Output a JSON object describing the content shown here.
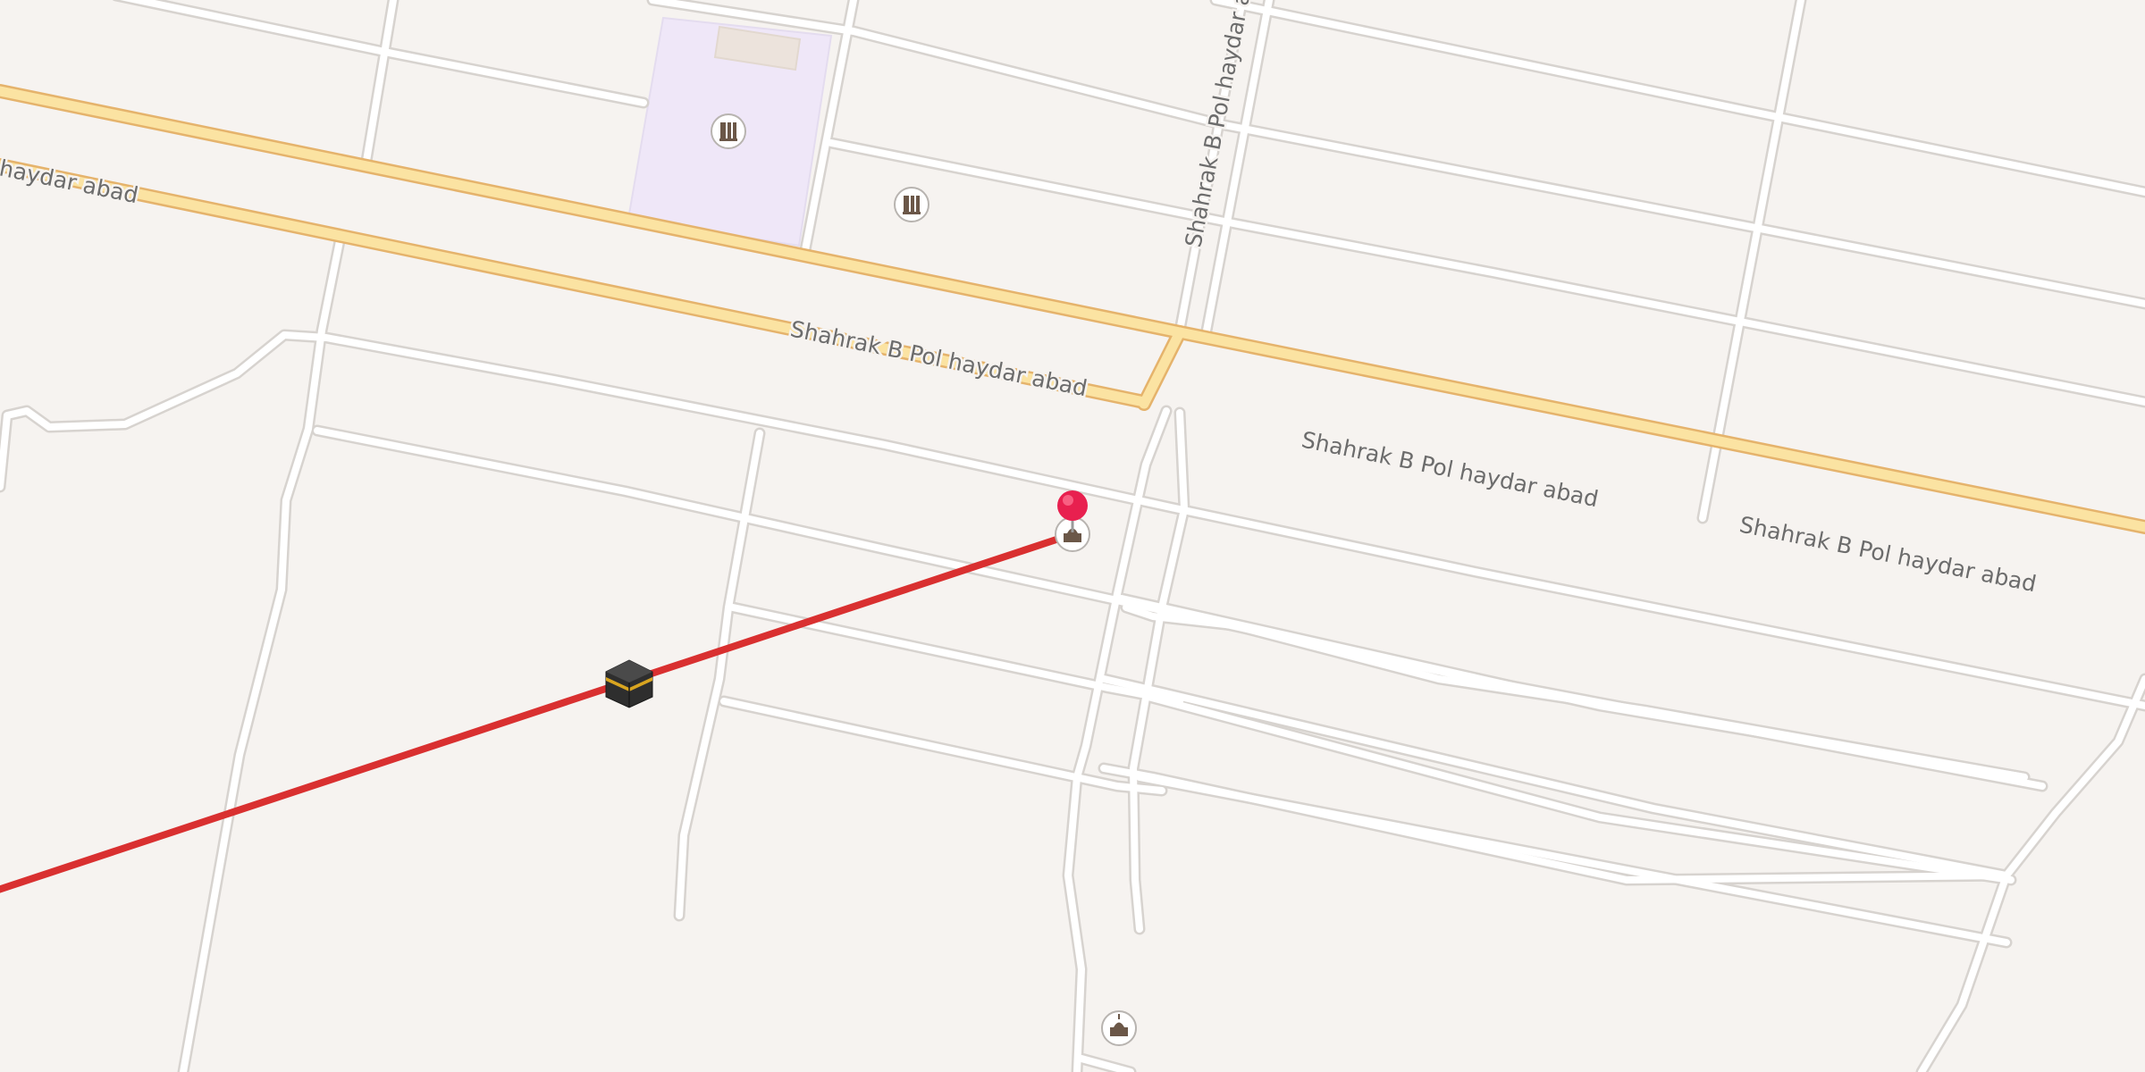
{
  "map": {
    "street_labels": [
      "haydar abad",
      "Shahrak B Pol haydar abad",
      "Shahrak B Pol haydar abad",
      "Shahrak B Pol haydar abad",
      "Shahrak B Pol haydar ab"
    ],
    "markers": {
      "location_pin": "location-pin-icon",
      "kaaba": "kaaba-icon",
      "qibla_line_color": "#d93030",
      "pin_color": "#e8204f"
    },
    "pois": [
      {
        "icon": "school-icon"
      },
      {
        "icon": "school-icon"
      },
      {
        "icon": "mosque-icon"
      },
      {
        "icon": "mosque-icon"
      }
    ],
    "colors": {
      "background": "#f6f3f0",
      "main_road": "#fbe3a2",
      "main_road_casing": "#e5b36c",
      "school_area": "#efe7f8"
    }
  }
}
